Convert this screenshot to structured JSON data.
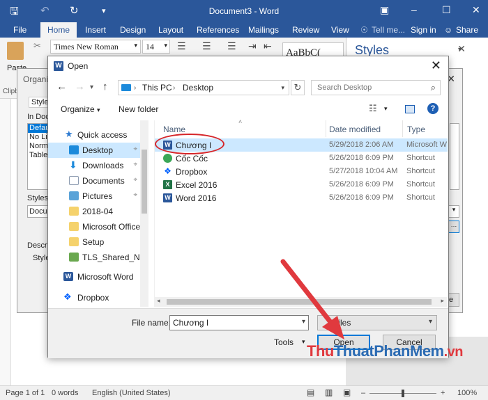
{
  "app": {
    "title": "Document3 - Word",
    "tabs": [
      "File",
      "Home",
      "Insert",
      "Design",
      "Layout",
      "References",
      "Mailings",
      "Review",
      "View"
    ],
    "active_tab": "Home",
    "tell_me": "Tell me...",
    "sign_in": "Sign in",
    "share": "Share",
    "paste_label": "Paste",
    "clipboard_label": "Clipb",
    "font_name": "Times New Roman",
    "font_size": "14",
    "style_sample": "AaBbC("
  },
  "styles_pane": {
    "title": "Styles"
  },
  "organizer": {
    "title": "Organiz",
    "styles_tab": "Styles",
    "in_doc_label": "In Doc",
    "items": [
      "Defau",
      "No Lis",
      "Norm",
      "Table"
    ],
    "styles_label": "Styles",
    "styles_value": "Docu",
    "description_label": "Descrip",
    "style_label": "Style"
  },
  "dialog": {
    "title": "Open",
    "address": [
      "This PC",
      "Desktop"
    ],
    "search_placeholder": "Search Desktop",
    "organize": "Organize",
    "new_folder": "New folder",
    "columns": {
      "name": "Name",
      "date": "Date modified",
      "type": "Type"
    },
    "nav_items": [
      {
        "label": "Quick access",
        "icon": "star-icon",
        "color": "#2b79d0"
      },
      {
        "label": "Desktop",
        "icon": "desktop-icon",
        "color": "#1c8adb",
        "selected": true,
        "pinned": true
      },
      {
        "label": "Downloads",
        "icon": "download-icon",
        "color": "#1c8adb",
        "pinned": true
      },
      {
        "label": "Documents",
        "icon": "documents-icon",
        "color": "#8c9bb0",
        "pinned": true
      },
      {
        "label": "Pictures",
        "icon": "pictures-icon",
        "color": "#5aa3d8",
        "pinned": true
      },
      {
        "label": "2018-04",
        "icon": "folder-icon",
        "color": "#f5d26c"
      },
      {
        "label": "Microsoft Office",
        "icon": "folder-icon",
        "color": "#f5d26c"
      },
      {
        "label": "Setup",
        "icon": "folder-icon",
        "color": "#f5d26c"
      },
      {
        "label": "TLS_Shared_Nga",
        "icon": "shared-folder-icon",
        "color": "#6aa84f"
      },
      {
        "label": "Microsoft Word",
        "icon": "word-icon",
        "color": "#2b579a"
      },
      {
        "label": "Dropbox",
        "icon": "dropbox-icon",
        "color": "#0061fe"
      }
    ],
    "files": [
      {
        "name": "Chương I",
        "date": "5/29/2018 2:06 AM",
        "type": "Microsoft W",
        "icon": "word-doc-icon",
        "color": "#2b579a",
        "selected": true
      },
      {
        "name": "Cốc Cốc",
        "date": "5/26/2018 6:09 PM",
        "type": "Shortcut",
        "icon": "coccoc-icon",
        "color": "#3aa757"
      },
      {
        "name": "Dropbox",
        "date": "5/27/2018 10:04 AM",
        "type": "Shortcut",
        "icon": "dropbox-icon",
        "color": "#0061fe"
      },
      {
        "name": "Excel 2016",
        "date": "5/26/2018 6:09 PM",
        "type": "Shortcut",
        "icon": "excel-icon",
        "color": "#217346"
      },
      {
        "name": "Word 2016",
        "date": "5/26/2018 6:09 PM",
        "type": "Shortcut",
        "icon": "word-icon",
        "color": "#2b579a"
      }
    ],
    "file_name_label": "File name:",
    "file_name_value": "Chương I",
    "filter_value": "Files",
    "tools": "Tools",
    "open_button": "Open",
    "cancel_button": "Cancel"
  },
  "status": {
    "page": "Page 1 of 1",
    "words": "0 words",
    "language": "English (United States)",
    "zoom": "100%"
  },
  "watermark": {
    "part1": "Thu",
    "part2": "ThuatPhanMem",
    "part3": ".vn"
  },
  "colors": {
    "word_blue": "#2b579a",
    "selection": "#cce8ff",
    "annotation_red": "#d6262a"
  }
}
